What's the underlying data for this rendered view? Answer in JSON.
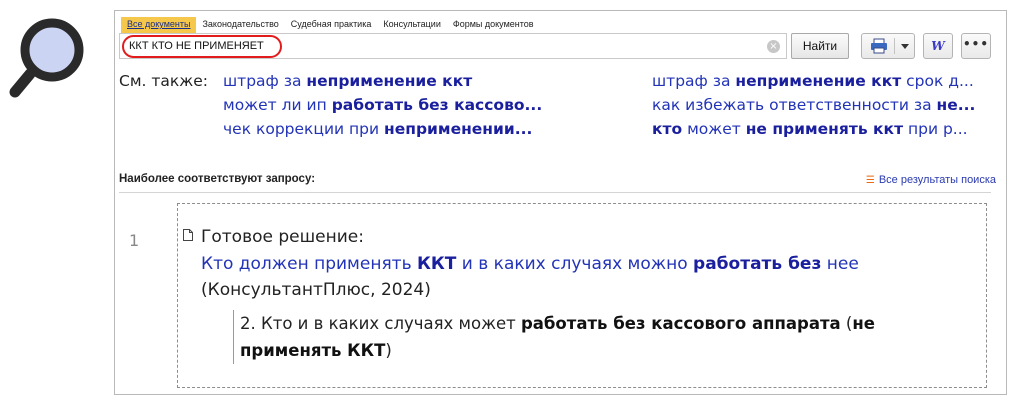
{
  "tabs": [
    {
      "label": "Все документы",
      "active": true
    },
    {
      "label": "Законодательство",
      "active": false
    },
    {
      "label": "Судебная практика",
      "active": false
    },
    {
      "label": "Консультации",
      "active": false
    },
    {
      "label": "Формы документов",
      "active": false
    }
  ],
  "search": {
    "value": "ККТ КТО НЕ ПРИМЕНЯЕТ",
    "highlight_color": "#e21c1c"
  },
  "toolbar": {
    "find_label": "Найти",
    "word_label": "W",
    "more_label": "•••"
  },
  "see_also": {
    "label": "См. также:",
    "left_items": [
      {
        "plain": "штраф за ",
        "bold": "неприменение ккт",
        "tail": ""
      },
      {
        "plain": "может ли ип ",
        "bold": "работать без кассово...",
        "tail": ""
      },
      {
        "plain": "чек коррекции при ",
        "bold": "неприменении...",
        "tail": ""
      }
    ],
    "right_items": [
      {
        "plain": "штраф за ",
        "bold": "неприменение ккт",
        "tail": " срок д..."
      },
      {
        "plain": "как избежать ответственности за ",
        "bold": "не...",
        "tail": ""
      },
      {
        "plain": "",
        "bold": "кто",
        "tail": " может ",
        "bold2": "не применять ккт",
        "tail2": " при р..."
      }
    ]
  },
  "results": {
    "heading": "Наиболее соответствуют запросу:",
    "all_results_label": "Все результаты поиска",
    "items": [
      {
        "number": "1",
        "type": "Готовое решение:",
        "title_parts": [
          {
            "text": "Кто должен применять ",
            "bold": false
          },
          {
            "text": "ККТ",
            "bold": true
          },
          {
            "text": " и в каких случаях можно ",
            "bold": false
          },
          {
            "text": "работать без",
            "bold": true
          },
          {
            "text": " нее",
            "bold": false
          }
        ],
        "source": "(КонсультантПлюс, 2024)",
        "snippet_parts": [
          {
            "text": "2. Кто и в каких случаях может ",
            "bold": false
          },
          {
            "text": "работать без кассового аппарата",
            "bold": true
          },
          {
            "text": " (",
            "bold": false
          },
          {
            "text": "не применять ККТ",
            "bold": true
          },
          {
            "text": ")",
            "bold": false
          }
        ]
      }
    ]
  },
  "colors": {
    "link": "#2233b8",
    "active_tab": "#f5c74a",
    "sort_icon": "#ea6a13"
  },
  "icons": {
    "magnifier": "magnifier-icon",
    "print": "printer-icon",
    "word": "word-export-icon",
    "more": "more-icon",
    "clear": "clear-icon",
    "document": "document-icon",
    "sort": "sort-icon"
  }
}
